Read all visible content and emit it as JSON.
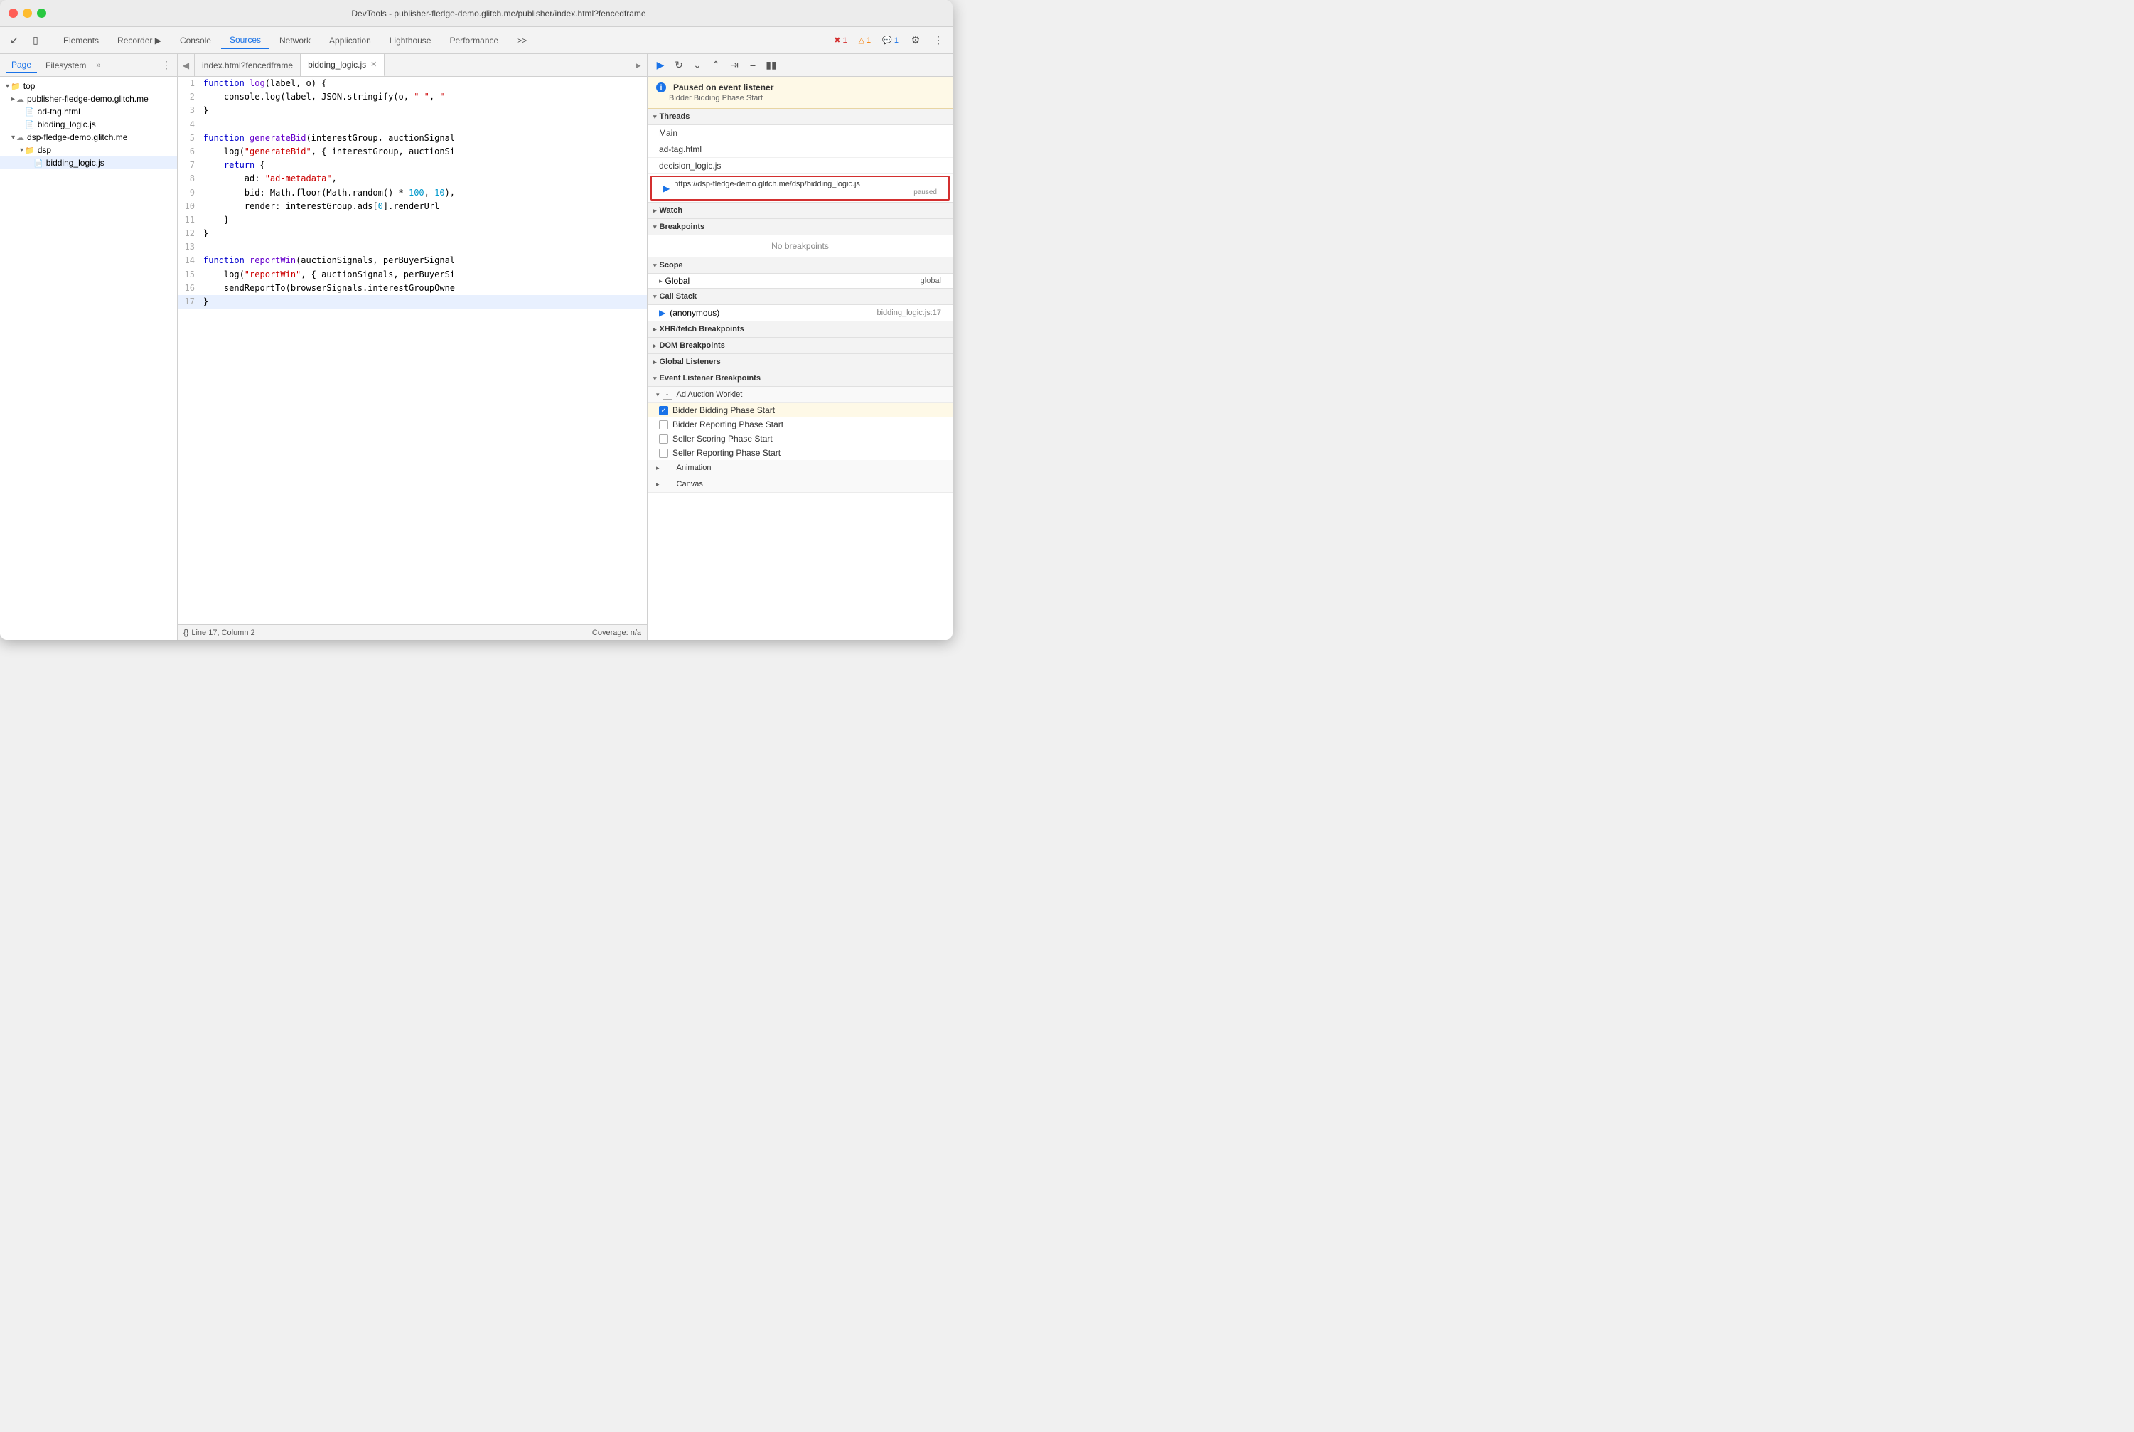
{
  "window": {
    "title": "DevTools - publisher-fledge-demo.glitch.me/publisher/index.html?fencedframe"
  },
  "toolbar": {
    "tabs": [
      {
        "label": "Elements",
        "active": false
      },
      {
        "label": "Recorder ▶",
        "active": false
      },
      {
        "label": "Console",
        "active": false
      },
      {
        "label": "Sources",
        "active": true
      },
      {
        "label": "Network",
        "active": false
      },
      {
        "label": "Application",
        "active": false
      },
      {
        "label": "Lighthouse",
        "active": false
      },
      {
        "label": "Performance",
        "active": false
      }
    ],
    "badges": {
      "error": "1",
      "warning": "1",
      "info": "1"
    },
    "more_label": ">>"
  },
  "file_panel": {
    "tabs": [
      {
        "label": "Page",
        "active": true
      },
      {
        "label": "Filesystem",
        "active": false
      }
    ],
    "more": "»",
    "tree": [
      {
        "indent": 0,
        "icon": "triangle-down",
        "type": "label",
        "label": "top"
      },
      {
        "indent": 1,
        "icon": "cloud",
        "type": "domain",
        "label": "publisher-fledge-demo.glitch.me"
      },
      {
        "indent": 2,
        "icon": "triangle-right",
        "type": "file",
        "label": "ad-tag.html"
      },
      {
        "indent": 2,
        "icon": "js",
        "type": "file",
        "label": "bidding_logic.js"
      },
      {
        "indent": 1,
        "icon": "triangle-down",
        "type": "domain",
        "label": "dsp-fledge-demo.glitch.me"
      },
      {
        "indent": 2,
        "icon": "triangle-down",
        "type": "folder",
        "label": "dsp"
      },
      {
        "indent": 3,
        "icon": "js",
        "type": "file",
        "label": "bidding_logic.js",
        "selected": true
      }
    ]
  },
  "editor": {
    "tabs": [
      {
        "label": "index.html?fencedframe",
        "active": false,
        "closeable": false
      },
      {
        "label": "bidding_logic.js",
        "active": true,
        "closeable": true
      }
    ],
    "code_lines": [
      {
        "num": 1,
        "code": "function log(label, o) {"
      },
      {
        "num": 2,
        "code": "    console.log(label, JSON.stringify(o, \" \", \""
      },
      {
        "num": 3,
        "code": "}"
      },
      {
        "num": 4,
        "code": ""
      },
      {
        "num": 5,
        "code": "function generateBid(interestGroup, auctionSignal"
      },
      {
        "num": 6,
        "code": "    log(\"generateBid\", { interestGroup, auctionSi"
      },
      {
        "num": 7,
        "code": "    return {"
      },
      {
        "num": 8,
        "code": "        ad: \"ad-metadata\","
      },
      {
        "num": 9,
        "code": "        bid: Math.floor(Math.random() * 100, 10),"
      },
      {
        "num": 10,
        "code": "        render: interestGroup.ads[0].renderUrl"
      },
      {
        "num": 11,
        "code": "    }"
      },
      {
        "num": 12,
        "code": "}"
      },
      {
        "num": 13,
        "code": ""
      },
      {
        "num": 14,
        "code": "function reportWin(auctionSignals, perBuyerSignal"
      },
      {
        "num": 15,
        "code": "    log(\"reportWin\", { auctionSignals, perBuyerSi"
      },
      {
        "num": 16,
        "code": "    sendReportTo(browserSignals.interestGroupOwne"
      },
      {
        "num": 17,
        "code": "}",
        "highlighted": true
      }
    ],
    "status": {
      "format_icon": "{}",
      "position": "Line 17, Column 2",
      "coverage": "Coverage: n/a"
    }
  },
  "debugger": {
    "toolbar_buttons": [
      "resume",
      "step-over",
      "step-into",
      "step-out",
      "step",
      "deactivate",
      "pause"
    ],
    "paused_banner": {
      "title": "Paused on event listener",
      "subtitle": "Bidder Bidding Phase Start"
    },
    "sections": {
      "threads": {
        "label": "Threads",
        "items": [
          {
            "label": "Main"
          },
          {
            "label": "ad-tag.html"
          },
          {
            "label": "decision_logic.js"
          },
          {
            "label": "https://dsp-fledge-demo.glitch.me/dsp/bidding_logic.js",
            "paused": "paused",
            "active": true,
            "has_arrow": true
          }
        ]
      },
      "watch": {
        "label": "Watch"
      },
      "breakpoints": {
        "label": "Breakpoints",
        "content": "No breakpoints"
      },
      "scope": {
        "label": "Scope",
        "items": [
          {
            "label": "Global",
            "value": "global"
          }
        ]
      },
      "call_stack": {
        "label": "Call Stack",
        "items": [
          {
            "label": "(anonymous)",
            "file": "bidding_logic.js:17",
            "has_arrow": true
          }
        ]
      },
      "xhr_fetch": {
        "label": "XHR/fetch Breakpoints"
      },
      "dom_breakpoints": {
        "label": "DOM Breakpoints"
      },
      "global_listeners": {
        "label": "Global Listeners"
      },
      "event_listener_breakpoints": {
        "label": "Event Listener Breakpoints",
        "subsections": [
          {
            "label": "Ad Auction Worklet",
            "items": [
              {
                "label": "Bidder Bidding Phase Start",
                "checked": true,
                "highlighted": true
              },
              {
                "label": "Bidder Reporting Phase Start",
                "checked": false
              },
              {
                "label": "Seller Scoring Phase Start",
                "checked": false
              },
              {
                "label": "Seller Reporting Phase Start",
                "checked": false
              }
            ]
          },
          {
            "label": "Animation",
            "items": []
          },
          {
            "label": "Canvas",
            "items": []
          }
        ]
      }
    }
  }
}
